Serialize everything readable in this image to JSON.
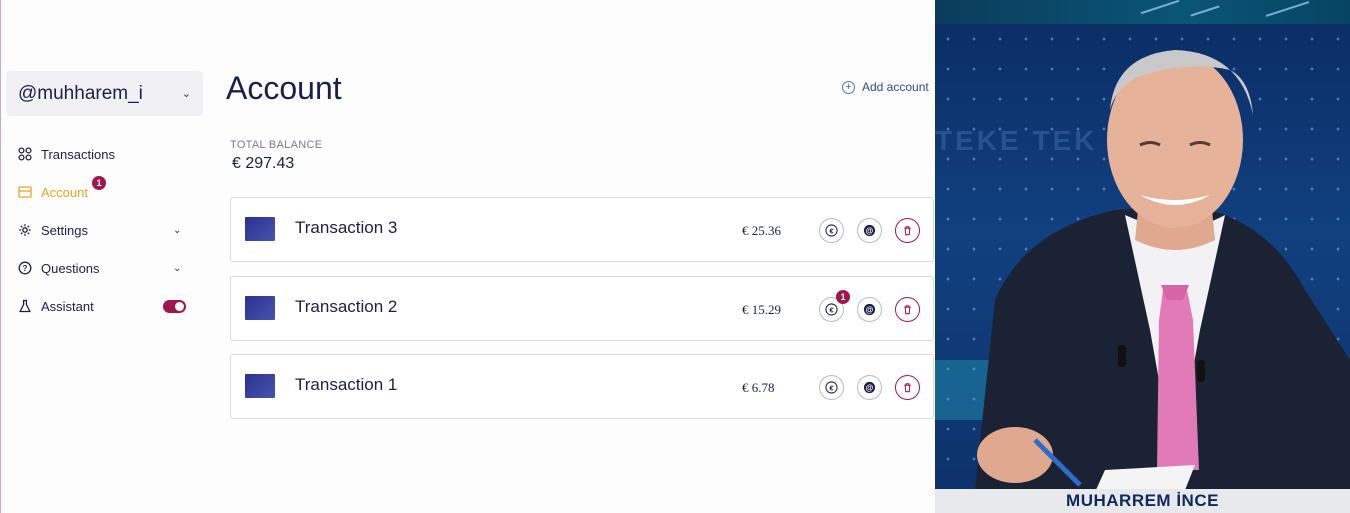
{
  "sidebar": {
    "username": "@muhharem_i",
    "items": [
      {
        "label": "Transactions",
        "icon": "grid-icon"
      },
      {
        "label": "Account",
        "icon": "wallet-icon",
        "badge": "1",
        "active": true
      },
      {
        "label": "Settings",
        "icon": "gear-icon",
        "expandable": true
      },
      {
        "label": "Questions",
        "icon": "question-icon",
        "expandable": true
      },
      {
        "label": "Assistant",
        "icon": "flask-icon",
        "toggle": true
      }
    ]
  },
  "main": {
    "title": "Account",
    "add_account_label": "Add account",
    "balance_label": "TOTAL BALANCE",
    "balance_value": "€ 297.43",
    "transactions": [
      {
        "name": "Transaction 3",
        "amount": "€ 25.36"
      },
      {
        "name": "Transaction 2",
        "amount": "€ 15.29",
        "badge": "1"
      },
      {
        "name": "Transaction 1",
        "amount": "€ 6.78"
      }
    ]
  },
  "video": {
    "caption": "MUHARREM İNCE",
    "background_text": "TEKE TEK"
  },
  "colors": {
    "accent": "#a3154f",
    "active_nav": "#e0a72a",
    "text": "#1c1f4a"
  }
}
